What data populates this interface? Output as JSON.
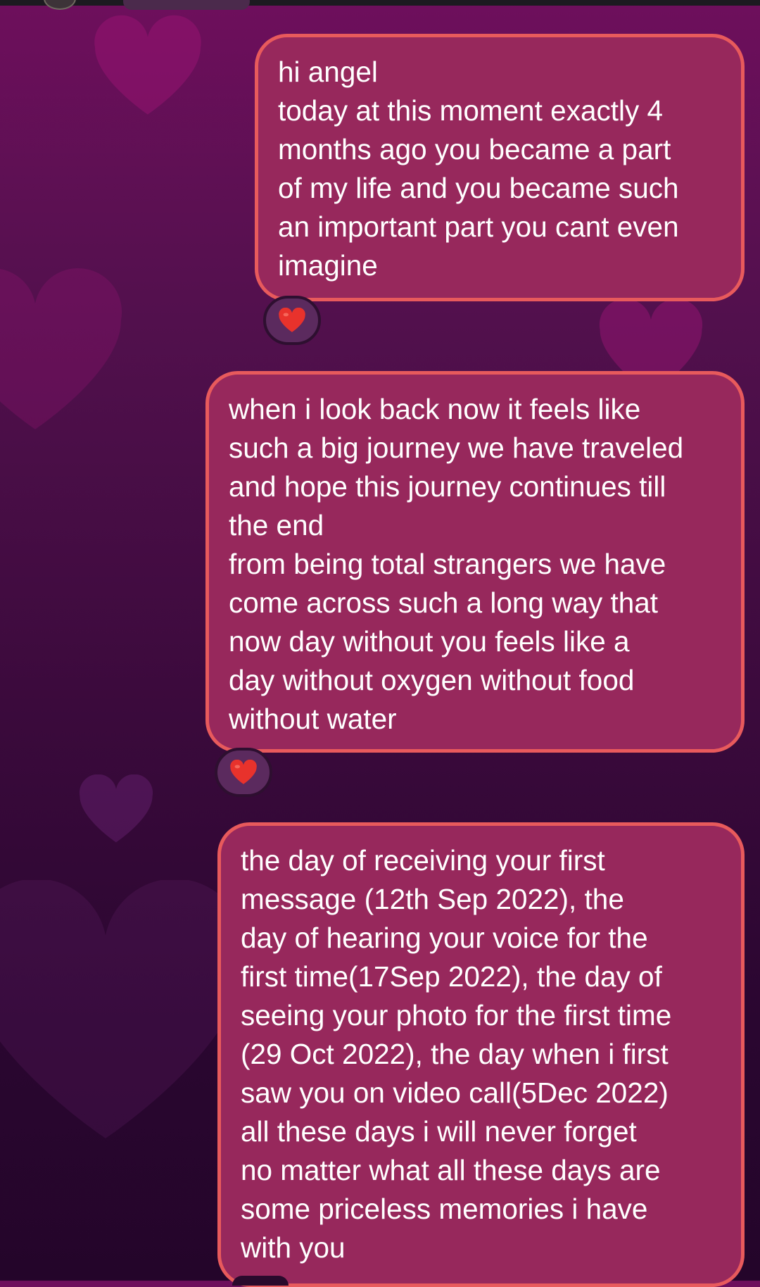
{
  "messages": [
    {
      "text": "hi angel\ntoday at this moment exactly 4\nmonths ago you became a part\nof my life and you became such\nan important part you cant even\nimagine",
      "reaction": "red-heart"
    },
    {
      "text": "when i look back now it feels like\nsuch a big journey we have traveled\nand hope this journey continues till\nthe end\nfrom being total strangers we have\ncome across such a long way that\nnow day without you feels like a\nday without oxygen without food\nwithout water",
      "reaction": "red-heart"
    },
    {
      "text": "the day of receiving your first\nmessage (12th Sep 2022), the\nday of hearing your voice for the\nfirst time(17Sep 2022), the day of\nseeing your photo for the first time\n(29 Oct 2022), the day when i first\nsaw you on video call(5Dec 2022)\nall these days i will never forget\nno matter what all these days are\nsome priceless memories i have\nwith you"
    }
  ],
  "colors": {
    "bubble_fill": "#97285c",
    "bubble_border": "#e85a5c",
    "reaction_heart": "#e8322c",
    "background_top": "#6e0f5c",
    "background_bottom": "#24052a"
  }
}
